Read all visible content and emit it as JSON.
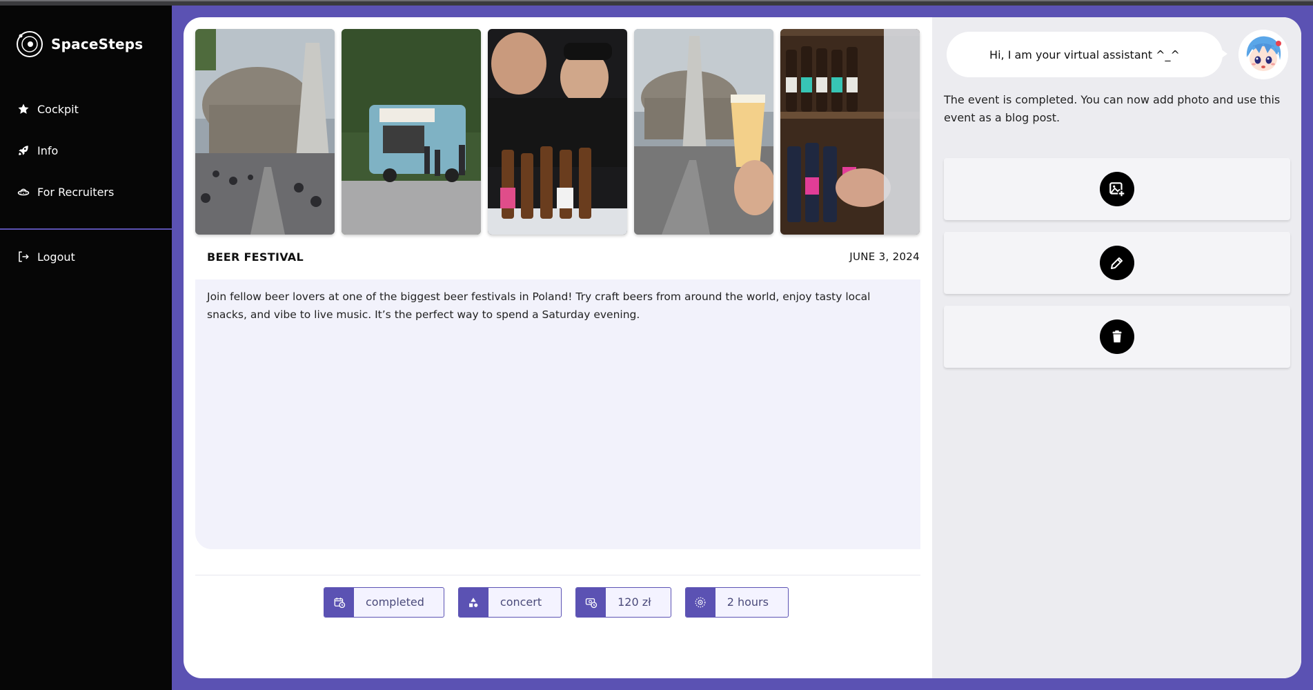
{
  "app": {
    "name": "SpaceSteps"
  },
  "sidebar": {
    "items": [
      {
        "label": "Cockpit",
        "icon": "star-icon"
      },
      {
        "label": "Info",
        "icon": "rocket-icon"
      },
      {
        "label": "For Recruiters",
        "icon": "ufo-icon"
      }
    ],
    "logout_label": "Logout"
  },
  "event": {
    "title": "BEER FESTIVAL",
    "date": "JUNE 3, 2024",
    "description": "Join fellow beer lovers at one of the biggest beer festivals in Poland! Try craft beers from around the world, enjoy tasty local snacks, and vibe to live music. It’s the perfect way to spend a Saturday evening.",
    "photos": [
      "festival-hall-crowd",
      "food-truck",
      "bartenders-pouring",
      "beer-glass-toast",
      "bottle-shelf"
    ],
    "tags": [
      {
        "label": "completed",
        "icon": "calendar-clock-icon"
      },
      {
        "label": "concert",
        "icon": "shapes-icon"
      },
      {
        "label": "120 zł",
        "icon": "money-clock-icon"
      },
      {
        "label": "2 hours",
        "icon": "timer-icon"
      }
    ]
  },
  "assistant": {
    "greeting": "Hi, I am your virtual assistant ^_^",
    "message": "The event is completed. You can now add photo and use this event as a blog post.",
    "actions": [
      {
        "name": "add-photo",
        "icon": "add-photo-icon"
      },
      {
        "name": "edit",
        "icon": "pencil-icon"
      },
      {
        "name": "delete",
        "icon": "trash-icon"
      }
    ]
  },
  "colors": {
    "accent": "#5b52b3",
    "sidebar_bg": "#060606",
    "panel_bg": "#ececf0",
    "description_bg": "#f2f2fb"
  }
}
